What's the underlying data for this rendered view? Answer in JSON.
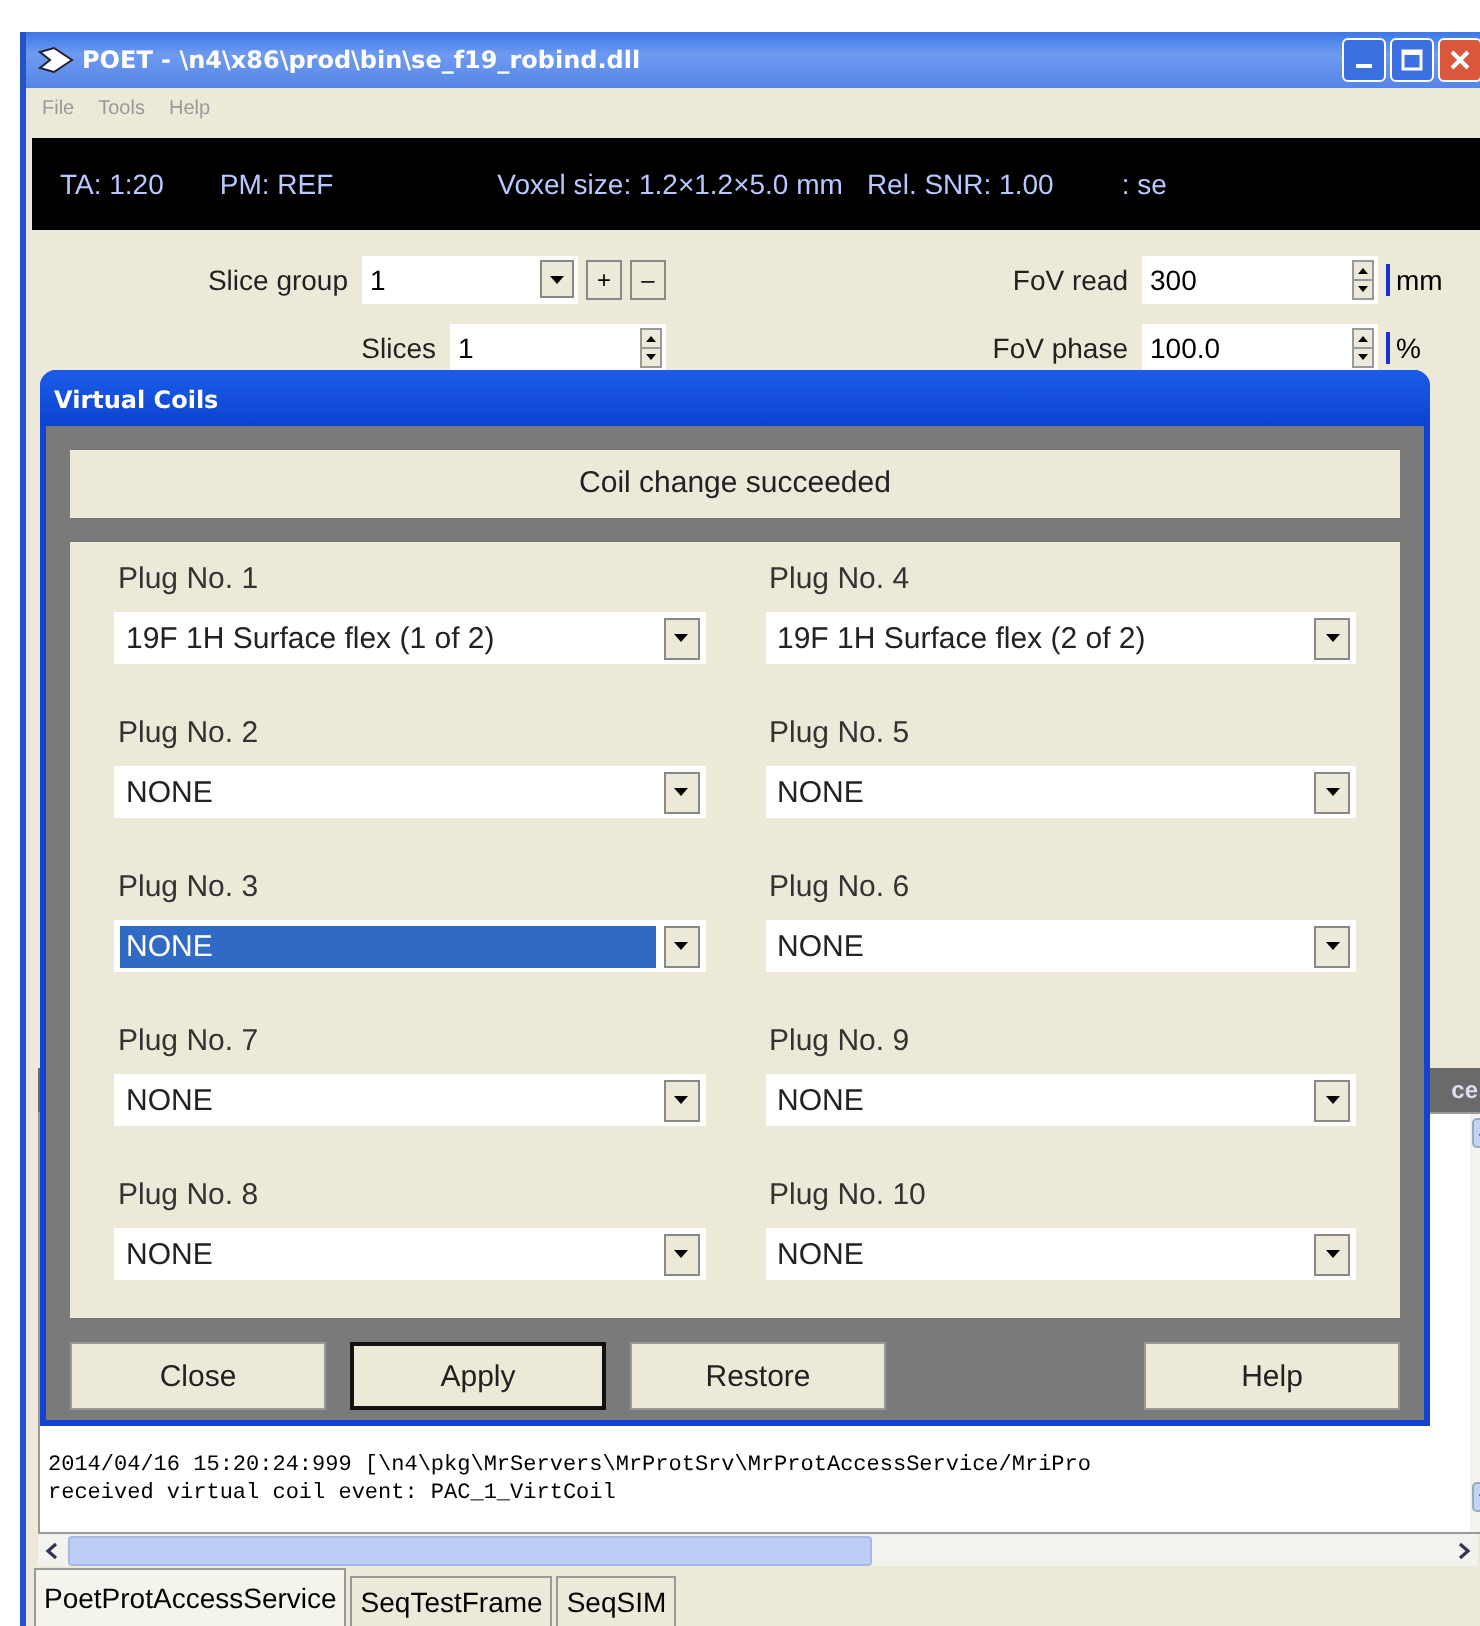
{
  "window": {
    "title": "POET - \\n4\\x86\\prod\\bin\\se_f19_robind.dll"
  },
  "menu": [
    "File",
    "Tools",
    "Help"
  ],
  "info_bar": [
    "TA: 1:20",
    "PM: REF",
    "Voxel size: 1.2×1.2×5.0 mm",
    "Rel. SNR: 1.00",
    ": se"
  ],
  "parameters": {
    "left": [
      {
        "label": "Slice group",
        "value": "1",
        "kind": "combo",
        "buttons": [
          "+",
          "–"
        ]
      },
      {
        "label": "Slices",
        "value": "1",
        "kind": "spin"
      }
    ],
    "right": [
      {
        "label": "FoV read",
        "value": "300",
        "kind": "spin",
        "unit": "mm"
      },
      {
        "label": "FoV phase",
        "value": "100.0",
        "kind": "spin",
        "unit": "%"
      }
    ]
  },
  "log_panel": {
    "header": "ce",
    "lines": [
      "2014/04/16 15:20:24:999  [\\n4\\pkg\\MrServers\\MrProtSrv\\MrProtAccessService/MriPro",
      "received virtual coil event: PAC_1_VirtCoil"
    ]
  },
  "tabs": [
    {
      "label": "PoetProtAccessService",
      "selected": true
    },
    {
      "label": "SeqTestFrame",
      "selected": false
    },
    {
      "label": "SeqSIM",
      "selected": false
    }
  ],
  "dialog": {
    "title": "Virtual Coils",
    "status": "Coil change succeeded",
    "plugs": [
      {
        "label": "Plug No. 1",
        "value": "19F 1H Surface flex (1 of 2)",
        "selected": false
      },
      {
        "label": "Plug No. 4",
        "value": "19F 1H Surface flex (2 of 2)",
        "selected": false
      },
      {
        "label": "Plug No. 2",
        "value": "NONE",
        "selected": false
      },
      {
        "label": "Plug No. 5",
        "value": "NONE",
        "selected": false
      },
      {
        "label": "Plug No. 3",
        "value": "NONE",
        "selected": true
      },
      {
        "label": "Plug No. 6",
        "value": "NONE",
        "selected": false
      },
      {
        "label": "Plug No. 7",
        "value": "NONE",
        "selected": false
      },
      {
        "label": "Plug No. 9",
        "value": "NONE",
        "selected": false
      },
      {
        "label": "Plug No. 8",
        "value": "NONE",
        "selected": false
      },
      {
        "label": "Plug No. 10",
        "value": "NONE",
        "selected": false
      }
    ],
    "buttons": [
      {
        "label": "Close",
        "default": false
      },
      {
        "label": "Apply",
        "default": true
      },
      {
        "label": "Restore",
        "default": false
      },
      {
        "label": "Help",
        "default": false
      }
    ]
  }
}
